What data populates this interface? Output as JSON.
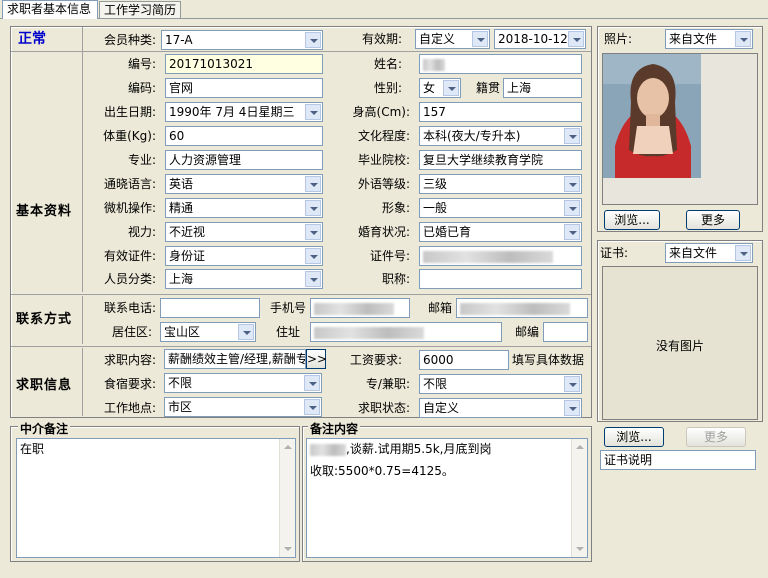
{
  "tabs": [
    "求职者基本信息",
    "工作学习简历"
  ],
  "status": "正常",
  "sections": {
    "basic": "基本资料",
    "contact": "联系方式",
    "job": "求职信息"
  },
  "fields": {
    "member_type": {
      "label": "会员种类:",
      "value": "17-A"
    },
    "validity": {
      "label": "有效期:",
      "value": "自定义",
      "date": "2018-10-12"
    },
    "number": {
      "label": "编号:",
      "value": "20171013021"
    },
    "name": {
      "label": "姓名:"
    },
    "code": {
      "label": "编码:",
      "value": "官网"
    },
    "gender": {
      "label": "性别:",
      "value": "女"
    },
    "native": {
      "label": "籍贯",
      "value": "上海"
    },
    "birth": {
      "label": "出生日期:",
      "value": "1990年 7月 4日星期三"
    },
    "height": {
      "label": "身高(Cm):",
      "value": "157"
    },
    "weight": {
      "label": "体重(Kg):",
      "value": "60"
    },
    "education": {
      "label": "文化程度:",
      "value": "本科(夜大/专升本)"
    },
    "major": {
      "label": "专业:",
      "value": "人力资源管理"
    },
    "school": {
      "label": "毕业院校:",
      "value": "复旦大学继续教育学院"
    },
    "language": {
      "label": "通晓语言:",
      "value": "英语"
    },
    "lang_level": {
      "label": "外语等级:",
      "value": "三级"
    },
    "computer": {
      "label": "微机操作:",
      "value": "精通"
    },
    "appearance": {
      "label": "形象:",
      "value": "一般"
    },
    "vision": {
      "label": "视力:",
      "value": "不近视"
    },
    "marriage": {
      "label": "婚育状况:",
      "value": "已婚已育"
    },
    "id_type": {
      "label": "有效证件:",
      "value": "身份证"
    },
    "id_no": {
      "label": "证件号:"
    },
    "category": {
      "label": "人员分类:",
      "value": "上海"
    },
    "title": {
      "label": "职称:"
    },
    "phone": {
      "label": "联系电话:"
    },
    "mobile": {
      "label": "手机号"
    },
    "email": {
      "label": "邮箱"
    },
    "district": {
      "label": "居住区:",
      "value": "宝山区"
    },
    "address": {
      "label": "住址"
    },
    "postcode": {
      "label": "邮编"
    },
    "job_content": {
      "label": "求职内容:",
      "value": "薪酬绩效主管/经理,薪酬专"
    },
    "salary": {
      "label": "工资要求:",
      "value": "6000",
      "hint": "填写具体数据"
    },
    "lodging": {
      "label": "食宿要求:",
      "value": "不限"
    },
    "parttime": {
      "label": "专/兼职:",
      "value": "不限"
    },
    "location": {
      "label": "工作地点:",
      "value": "市区"
    },
    "job_status": {
      "label": "求职状态:",
      "value": "自定义"
    }
  },
  "notes": {
    "agent_title": "中介备注",
    "agent_text": "在职",
    "remark_title": "备注内容",
    "remark_line1": ",谈薪.试用期5.5k,月底到岗",
    "remark_line2": "收取:5500*0.75=4125。"
  },
  "photo": {
    "label": "照片:",
    "source": "来自文件",
    "browse": "浏览...",
    "more": "更多"
  },
  "cert": {
    "label": "证书:",
    "source": "来自文件",
    "empty": "没有图片",
    "browse": "浏览...",
    "more": "更多",
    "desc": "证书说明"
  },
  "job_more_btn": ">>"
}
